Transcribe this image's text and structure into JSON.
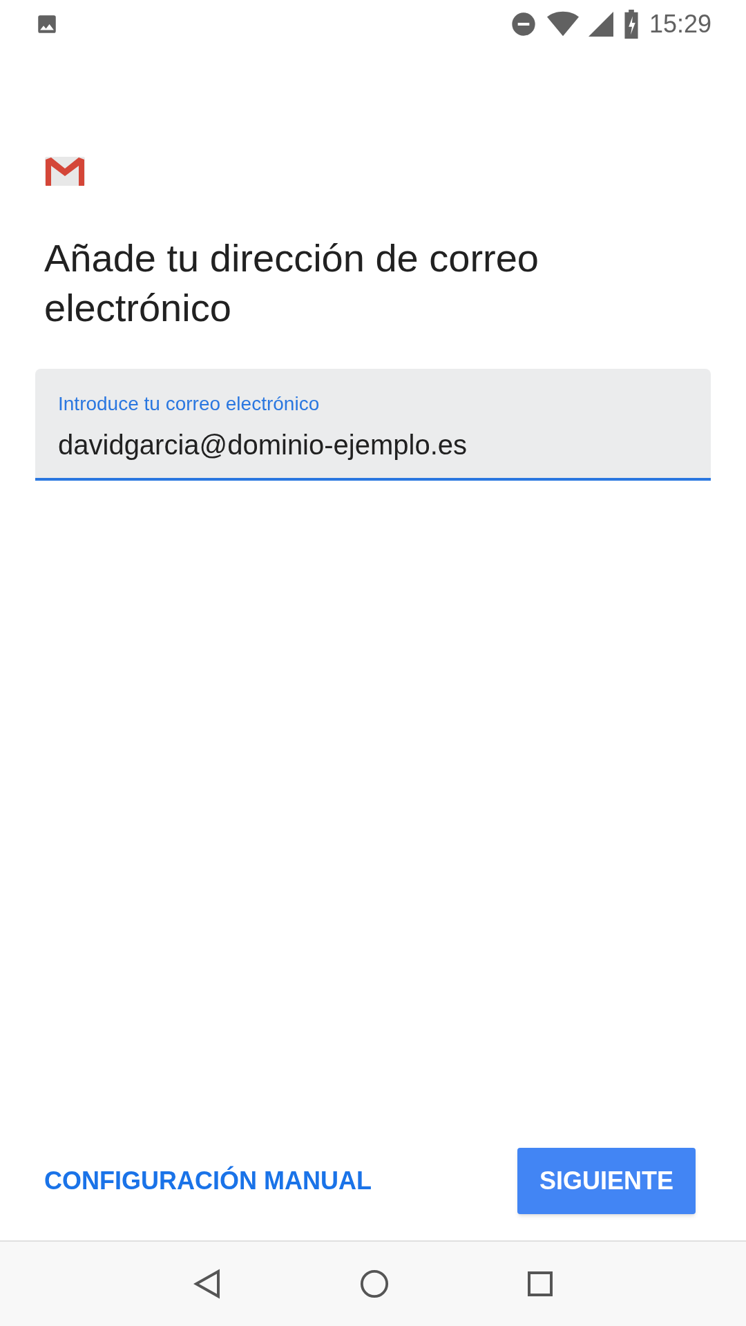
{
  "status_bar": {
    "time": "15:29"
  },
  "title": "Añade tu dirección de correo electrónico",
  "email_field": {
    "label": "Introduce tu correo electrónico",
    "value": "davidgarcia@dominio-ejemplo.es",
    "focused": true
  },
  "actions": [
    {
      "label": "CONFIGURACIÓN MANUAL",
      "kind": "text"
    },
    {
      "label": "SIGUIENTE",
      "kind": "filled"
    }
  ]
}
